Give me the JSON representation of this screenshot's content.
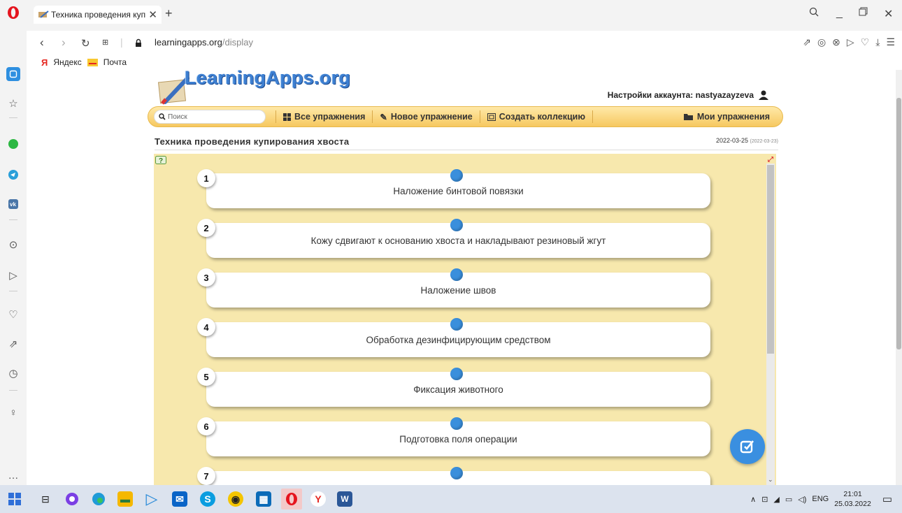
{
  "browser": {
    "tab_title": "Техника проведения купи",
    "url_domain": "learningapps.org",
    "url_path": "/display",
    "bookmarks": [
      {
        "label": "Яндекс"
      },
      {
        "label": "Почта"
      }
    ]
  },
  "site": {
    "logo": "LearningApps.org",
    "account_label": "Настройки аккаунта: nastyazayzeva",
    "search_placeholder": "Поиск",
    "menu": {
      "all_exercises": "Все упражнения",
      "new_exercise": "Новое упражнение",
      "create_collection": "Создать коллекцию",
      "my_exercises": "Мои упражнения"
    },
    "page_title": "Техника проведения купирования хвоста",
    "date": "2022-03-25",
    "date_created": "(2022-03-23)"
  },
  "exercise": {
    "items": [
      {
        "num": "1",
        "text": "Наложение бинтовой повязки"
      },
      {
        "num": "2",
        "text": "Кожу сдвигают к основанию хвоста и накладывают резиновый жгут"
      },
      {
        "num": "3",
        "text": "Наложение швов"
      },
      {
        "num": "4",
        "text": "Обработка дезинфицирующим средством"
      },
      {
        "num": "5",
        "text": "Фиксация животного"
      },
      {
        "num": "6",
        "text": "Подготовка поля операции"
      },
      {
        "num": "7",
        "text": ""
      }
    ],
    "accent_color": "#3a8fdc",
    "background_color": "#f7e8ad"
  },
  "taskbar": {
    "language": "ENG",
    "time": "21:01",
    "date": "25.03.2022"
  }
}
